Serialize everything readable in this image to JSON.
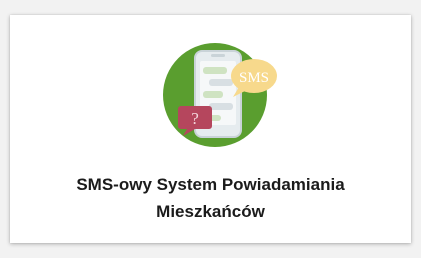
{
  "card": {
    "title_line1": "SMS-owy System Powiadamiania",
    "title_line2": "Mieszkańców"
  },
  "illustration": {
    "bubble_sms_text": "SMS",
    "bubble_question_text": "?",
    "colors": {
      "circle": "#5a9e2f",
      "sms_bubble": "#f7d98c",
      "question_bubble": "#b5465d",
      "phone": "#e9eef1"
    }
  }
}
